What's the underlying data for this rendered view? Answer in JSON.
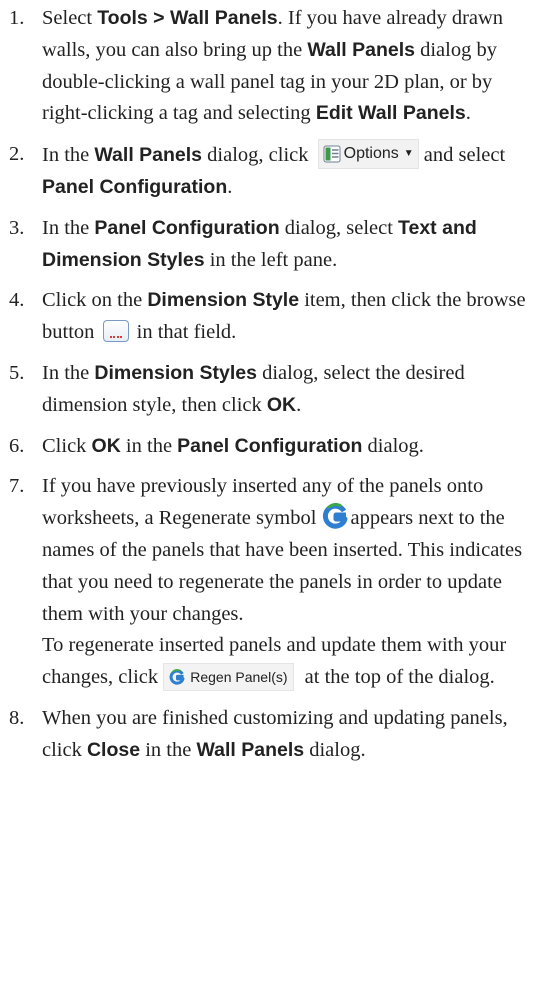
{
  "steps": [
    {
      "num": "1.",
      "t1": "Select ",
      "b1": "Tools > Wall Panels",
      "t2": ". If you have already drawn walls, you can also bring up the ",
      "b2": "Wall Panels",
      "t3": " dialog by double-clicking a wall panel tag in your 2D plan, or by right-clicking a tag and selecting ",
      "b3": "Edit Wall Panels",
      "t4": "."
    },
    {
      "num": "2.",
      "t1": "In the ",
      "b1": "Wall Panels",
      "t2": " dialog, click ",
      "button": "Options",
      "t3": " and select ",
      "b2": "Panel Configuration",
      "t4": "."
    },
    {
      "num": "3.",
      "t1": "In the ",
      "b1": "Panel Configuration",
      "t2": " dialog, select ",
      "b2": "Text and Dimension Styles",
      "t3": " in the left pane."
    },
    {
      "num": "4.",
      "t1": "Click on the ",
      "b1": "Dimension Style",
      "t2": " item, then click the browse button ",
      "t3": " in that field."
    },
    {
      "num": "5.",
      "t1": "In the ",
      "b1": "Dimension Styles",
      "t2": " dialog, select the desired dimension style, then click ",
      "b2": "OK",
      "t3": "."
    },
    {
      "num": "6.",
      "t1": "Click ",
      "b1": "OK",
      "t2": " in the ",
      "b2": "Panel Configuration",
      "t3": " dialog."
    },
    {
      "num": "7.",
      "t1": "If you have previously inserted any of the panels onto worksheets, a Regenerate symbol ",
      "t2": "appears next to the names of the panels that have been inserted. This indicates that you need to regenerate the panels in order to update them with your changes.",
      "sub1": "To regenerate inserted panels and update them with your changes, click ",
      "button": "Regen Panel(s)",
      "sub2": " at the top of the dialog."
    },
    {
      "num": "8.",
      "t1": "When you are finished customizing and updating panels, click ",
      "b1": "Close",
      "t2": " in the ",
      "b2": "Wall Panels",
      "t3": " dialog."
    }
  ],
  "colors": {
    "regen_blue": "#2f7fd0",
    "regen_green": "#3aa84a",
    "options_icon_green": "#3c9a4a"
  },
  "icons": {
    "options": "options-panel-icon",
    "browse": "browse-button-icon",
    "regen": "regenerate-icon"
  }
}
